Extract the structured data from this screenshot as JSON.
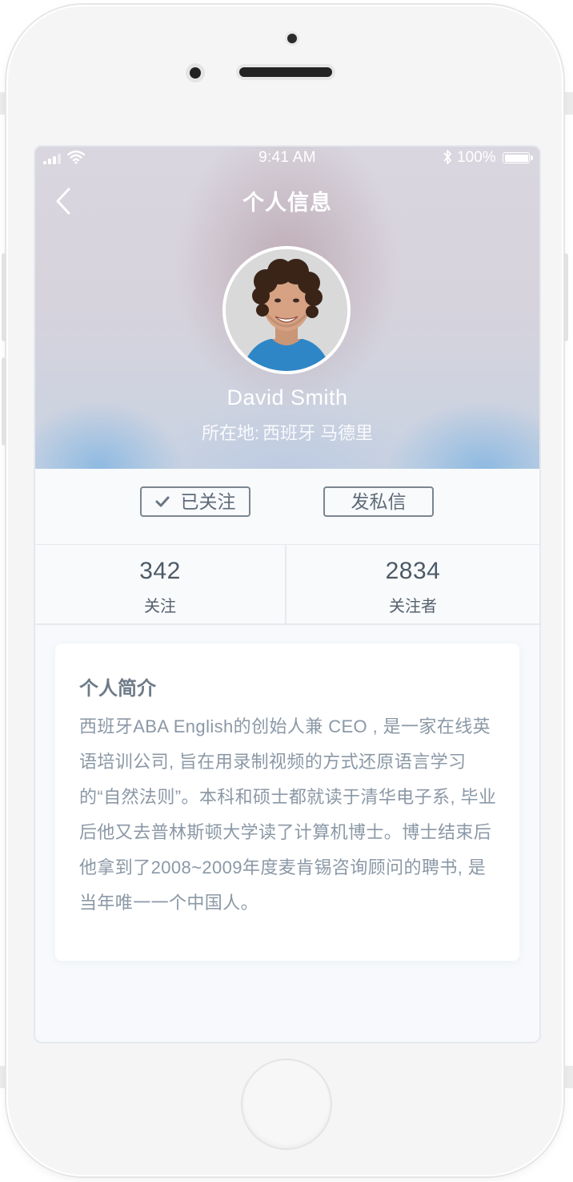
{
  "status_bar": {
    "time": "9:41 AM",
    "battery": "100%"
  },
  "nav": {
    "title": "个人信息"
  },
  "profile": {
    "name": "David Smith",
    "location_label": "所在地:",
    "location_value": "西班牙 马德里"
  },
  "actions": {
    "follow_label": "已关注",
    "message_label": "发私信"
  },
  "stats": {
    "following_count": "342",
    "following_label": "关注",
    "followers_count": "2834",
    "followers_label": "关注者"
  },
  "bio": {
    "title": "个人简介",
    "text": "西班牙ABA English的创始人兼 CEO , 是一家在线英语培训公司, 旨在用录制视频的方式还原语言学习的“自然法则”。本科和硕士都就读于清华电子系, 毕业后他又去普林斯顿大学读了计算机博士。博士结束后他拿到了2008~2009年度麦肯锡咨询顾问的聘书, 是当年唯一一个中国人。"
  },
  "icons": {
    "back": "chevron-left-icon",
    "signal": "signal-icon",
    "wifi": "wifi-icon",
    "bluetooth": "bluetooth-icon",
    "battery": "battery-icon",
    "check": "check-icon"
  },
  "colors": {
    "text_primary": "#4e5a66",
    "text_secondary": "#8b98a6",
    "border": "#e6e9ee",
    "button_border": "#7b8590"
  }
}
